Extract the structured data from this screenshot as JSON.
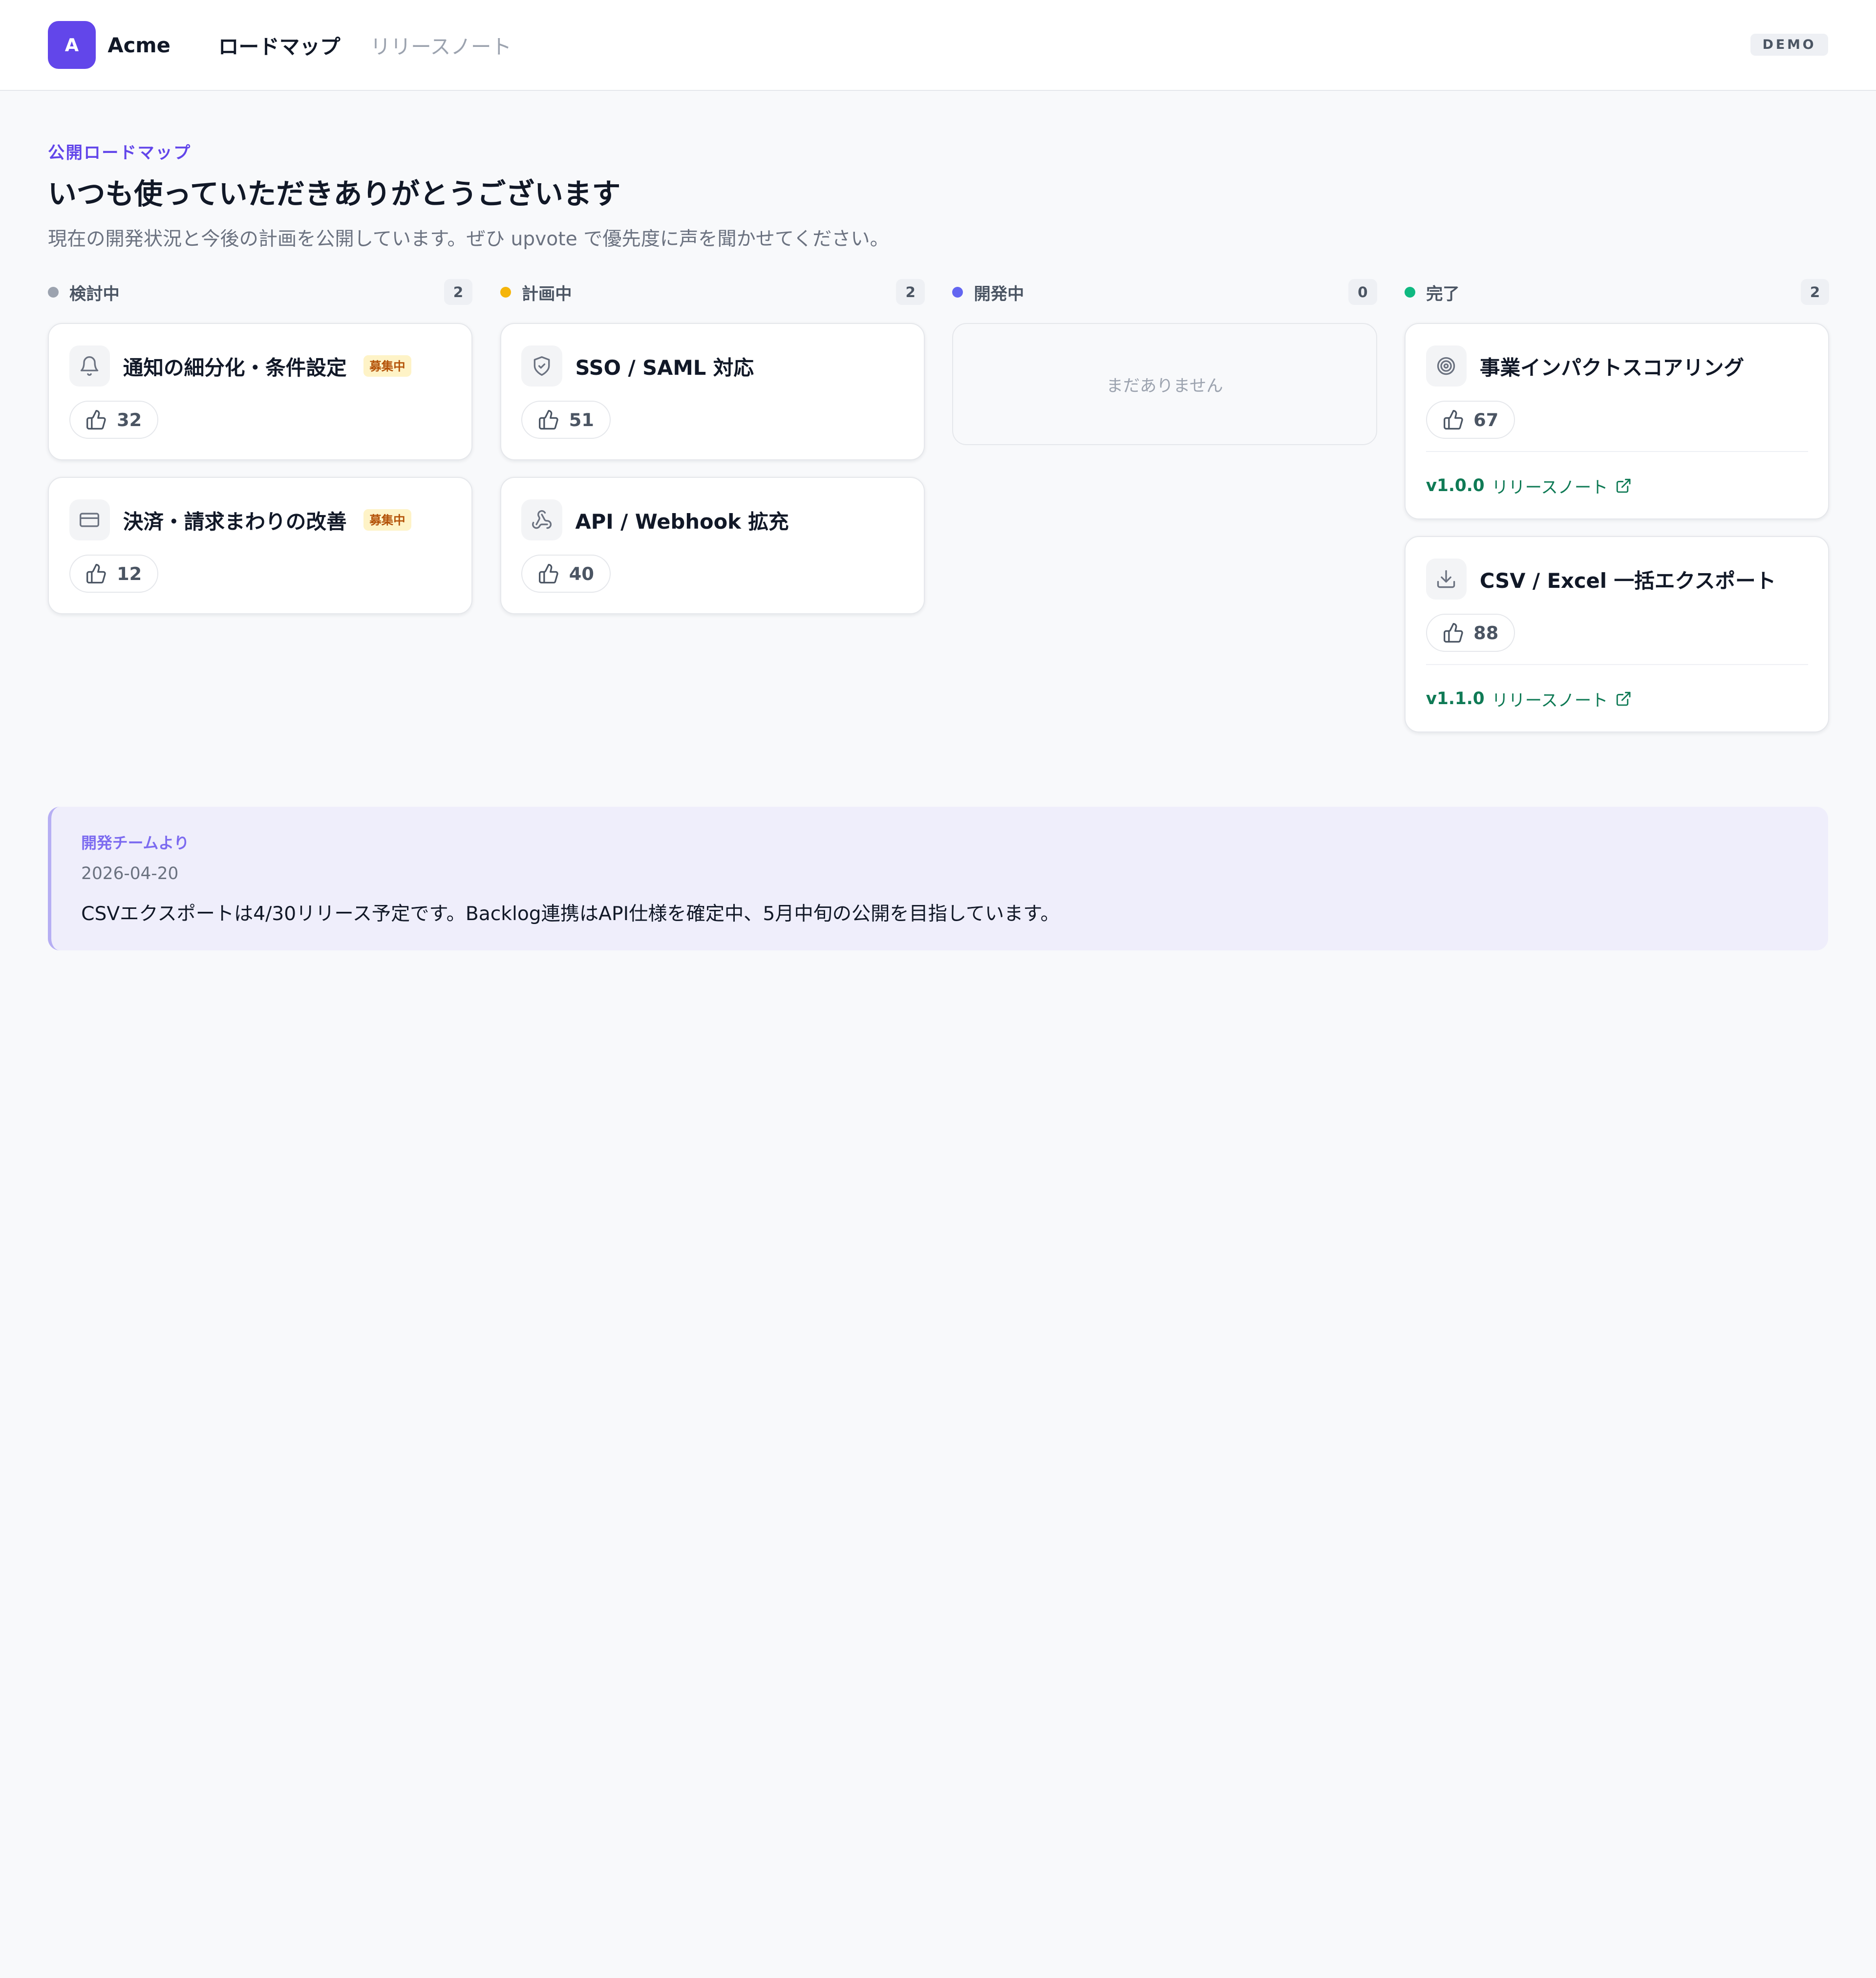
{
  "header": {
    "logo_letter": "A",
    "brand": "Acme",
    "nav": [
      {
        "label": "ロードマップ",
        "active": true
      },
      {
        "label": "リリースノート",
        "active": false
      }
    ],
    "env_badge": "DEMO"
  },
  "intro": {
    "eyebrow": "公開ロードマップ",
    "title": "いつも使っていただきありがとうございます",
    "subtitle": "現在の開発状況と今後の計画を公開しています。ぜひ upvote で優先度に声を聞かせてください。"
  },
  "columns": [
    {
      "title": "検討中",
      "count": "2",
      "dot_color": "#9ca3af",
      "cards": [
        {
          "icon": "bell-icon",
          "title": "通知の細分化・条件設定",
          "badge": "募集中",
          "votes": "32"
        },
        {
          "icon": "credit-card-icon",
          "title": "決済・請求まわりの改善",
          "badge": "募集中",
          "votes": "12"
        }
      ]
    },
    {
      "title": "計画中",
      "count": "2",
      "dot_color": "#f5b50a",
      "cards": [
        {
          "icon": "shield-icon",
          "title": "SSO / SAML 対応",
          "votes": "51"
        },
        {
          "icon": "webhook-icon",
          "title": "API / Webhook 拡充",
          "votes": "40"
        }
      ]
    },
    {
      "title": "開発中",
      "count": "0",
      "dot_color": "#6366f1",
      "empty_text": "まだありません"
    },
    {
      "title": "完了",
      "count": "2",
      "dot_color": "#10b981",
      "cards": [
        {
          "icon": "target-icon",
          "title": "事業インパクトスコアリング",
          "votes": "67",
          "release_version": "v1.0.0",
          "release_label": "リリースノート"
        },
        {
          "icon": "download-icon",
          "title": "CSV / Excel 一括エクスポート",
          "votes": "88",
          "release_version": "v1.1.0",
          "release_label": "リリースノート"
        }
      ]
    }
  ],
  "team_note": {
    "label": "開発チームより",
    "date": "2026-04-20",
    "body": "CSVエクスポートは4/30リリース予定です。Backlog連携はAPI仕様を確定中、5月中旬の公開を目指しています。"
  }
}
